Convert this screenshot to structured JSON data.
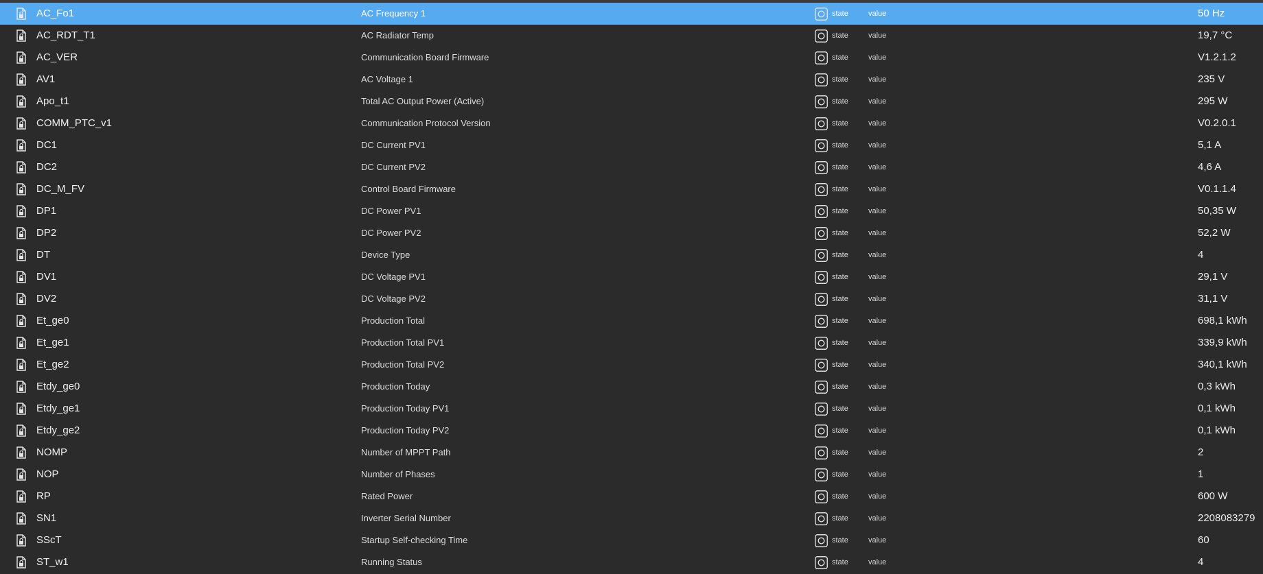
{
  "colors": {
    "background": "#2b2b2b",
    "selected_row": "#55aaf0",
    "text": "#e6e6e6"
  },
  "icons": {
    "row_icon": "file-lock-icon",
    "role_icon": "state-circle-icon"
  },
  "rows": [
    {
      "id": "AC_Fo1",
      "name": "AC Frequency 1",
      "role": "state",
      "type": "value",
      "value": "50 Hz",
      "selected": true
    },
    {
      "id": "AC_RDT_T1",
      "name": "AC Radiator Temp",
      "role": "state",
      "type": "value",
      "value": "19,7 °C"
    },
    {
      "id": "AC_VER",
      "name": "Communication Board Firmware",
      "role": "state",
      "type": "value",
      "value": "V1.2.1.2"
    },
    {
      "id": "AV1",
      "name": "AC Voltage 1",
      "role": "state",
      "type": "value",
      "value": "235 V"
    },
    {
      "id": "Apo_t1",
      "name": "Total AC Output Power (Active)",
      "role": "state",
      "type": "value",
      "value": "295 W"
    },
    {
      "id": "COMM_PTC_v1",
      "name": "Communication Protocol Version",
      "role": "state",
      "type": "value",
      "value": "V0.2.0.1"
    },
    {
      "id": "DC1",
      "name": "DC Current PV1",
      "role": "state",
      "type": "value",
      "value": "5,1 A"
    },
    {
      "id": "DC2",
      "name": "DC Current PV2",
      "role": "state",
      "type": "value",
      "value": "4,6 A"
    },
    {
      "id": "DC_M_FV",
      "name": "Control Board Firmware",
      "role": "state",
      "type": "value",
      "value": "V0.1.1.4"
    },
    {
      "id": "DP1",
      "name": "DC Power PV1",
      "role": "state",
      "type": "value",
      "value": "50,35 W"
    },
    {
      "id": "DP2",
      "name": "DC Power PV2",
      "role": "state",
      "type": "value",
      "value": "52,2 W"
    },
    {
      "id": "DT",
      "name": "Device Type",
      "role": "state",
      "type": "value",
      "value": "4"
    },
    {
      "id": "DV1",
      "name": "DC Voltage PV1",
      "role": "state",
      "type": "value",
      "value": "29,1 V"
    },
    {
      "id": "DV2",
      "name": "DC Voltage PV2",
      "role": "state",
      "type": "value",
      "value": "31,1 V"
    },
    {
      "id": "Et_ge0",
      "name": "Production Total",
      "role": "state",
      "type": "value",
      "value": "698,1 kWh"
    },
    {
      "id": "Et_ge1",
      "name": "Production Total PV1",
      "role": "state",
      "type": "value",
      "value": "339,9 kWh"
    },
    {
      "id": "Et_ge2",
      "name": "Production Total PV2",
      "role": "state",
      "type": "value",
      "value": "340,1 kWh"
    },
    {
      "id": "Etdy_ge0",
      "name": "Production Today",
      "role": "state",
      "type": "value",
      "value": "0,3 kWh"
    },
    {
      "id": "Etdy_ge1",
      "name": "Production Today PV1",
      "role": "state",
      "type": "value",
      "value": "0,1 kWh"
    },
    {
      "id": "Etdy_ge2",
      "name": "Production Today PV2",
      "role": "state",
      "type": "value",
      "value": "0,1 kWh"
    },
    {
      "id": "NOMP",
      "name": "Number of MPPT Path",
      "role": "state",
      "type": "value",
      "value": "2"
    },
    {
      "id": "NOP",
      "name": "Number of Phases",
      "role": "state",
      "type": "value",
      "value": "1"
    },
    {
      "id": "RP",
      "name": "Rated Power",
      "role": "state",
      "type": "value",
      "value": "600 W"
    },
    {
      "id": "SN1",
      "name": "Inverter Serial Number",
      "role": "state",
      "type": "value",
      "value": "2208083279"
    },
    {
      "id": "SScT",
      "name": "Startup Self-checking Time",
      "role": "state",
      "type": "value",
      "value": "60"
    },
    {
      "id": "ST_w1",
      "name": "Running Status",
      "role": "state",
      "type": "value",
      "value": "4"
    }
  ]
}
